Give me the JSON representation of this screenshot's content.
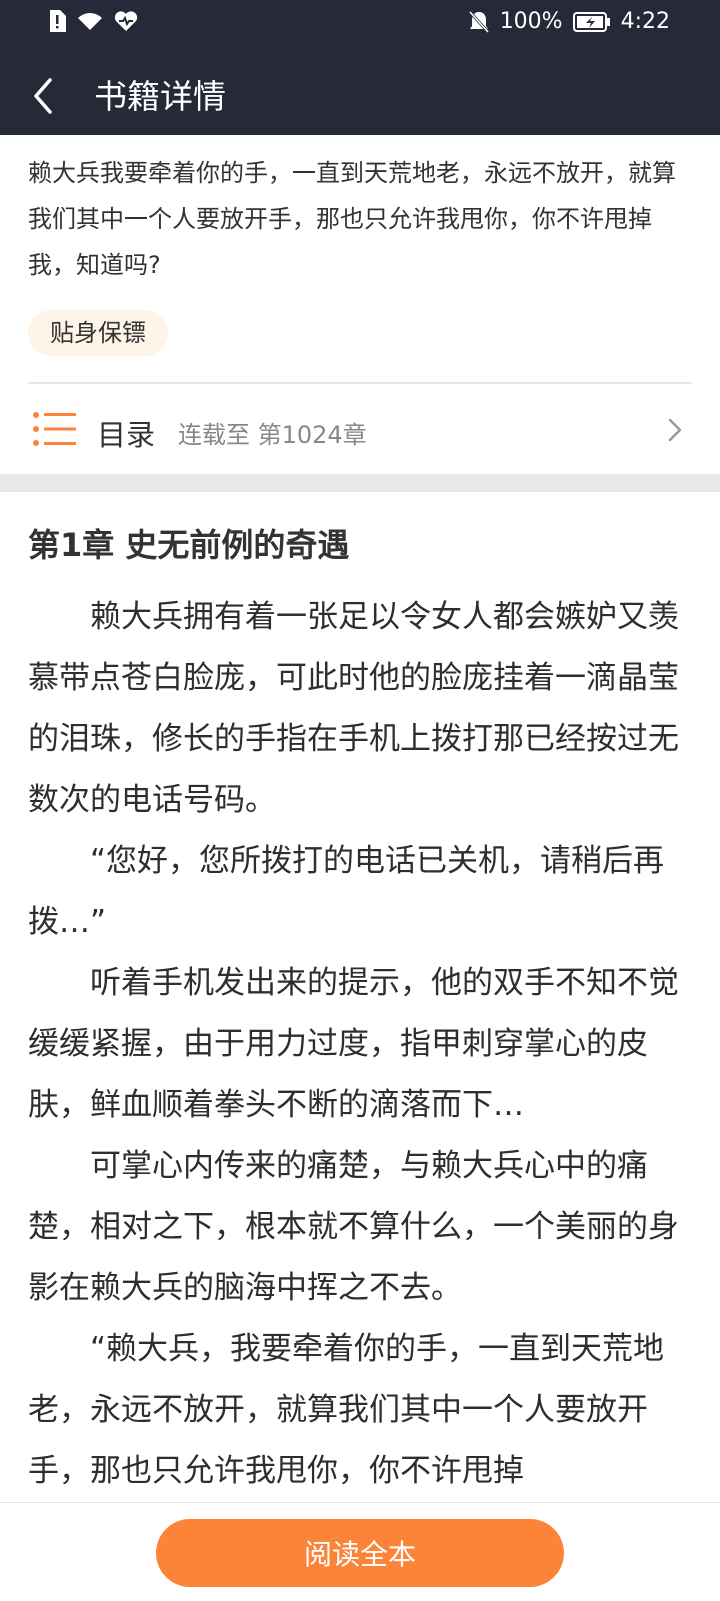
{
  "status_bar": {
    "battery_pct": "100%",
    "time": "4:22"
  },
  "header": {
    "title": "书籍详情"
  },
  "intro": {
    "text": "赖大兵我要牵着你的手，一直到天荒地老，永远不放开，就算我们其中一个人要放开手，那也只允许我甩你，你不许甩掉我，知道吗?",
    "tag": "贴身保镖"
  },
  "toc": {
    "label": "目录",
    "status": "连载至 第1024章"
  },
  "chapter": {
    "title": "第1章 史无前例的奇遇",
    "paragraphs": [
      "赖大兵拥有着一张足以令女人都会嫉妒又羡慕带点苍白脸庞，可此时他的脸庞挂着一滴晶莹的泪珠，修长的手指在手机上拨打那已经按过无数次的电话号码。",
      "“您好，您所拨打的电话已关机，请稍后再拨…”",
      "听着手机发出来的提示，他的双手不知不觉缓缓紧握，由于用力过度，指甲刺穿掌心的皮肤，鲜血顺着拳头不断的滴落而下…",
      "可掌心内传来的痛楚，与赖大兵心中的痛楚，相对之下，根本就不算什么，一个美丽的身影在赖大兵的脑海中挥之不去。",
      "“赖大兵，我要牵着你的手，一直到天荒地老，永远不放开，就算我们其中一个人要放开手，那也只允许我甩你，你不许甩掉"
    ]
  },
  "footer": {
    "read_button": "阅读全本"
  },
  "colors": {
    "header_bg": "#262a38",
    "accent": "#fb8438",
    "tag_bg": "#fff4e8"
  }
}
